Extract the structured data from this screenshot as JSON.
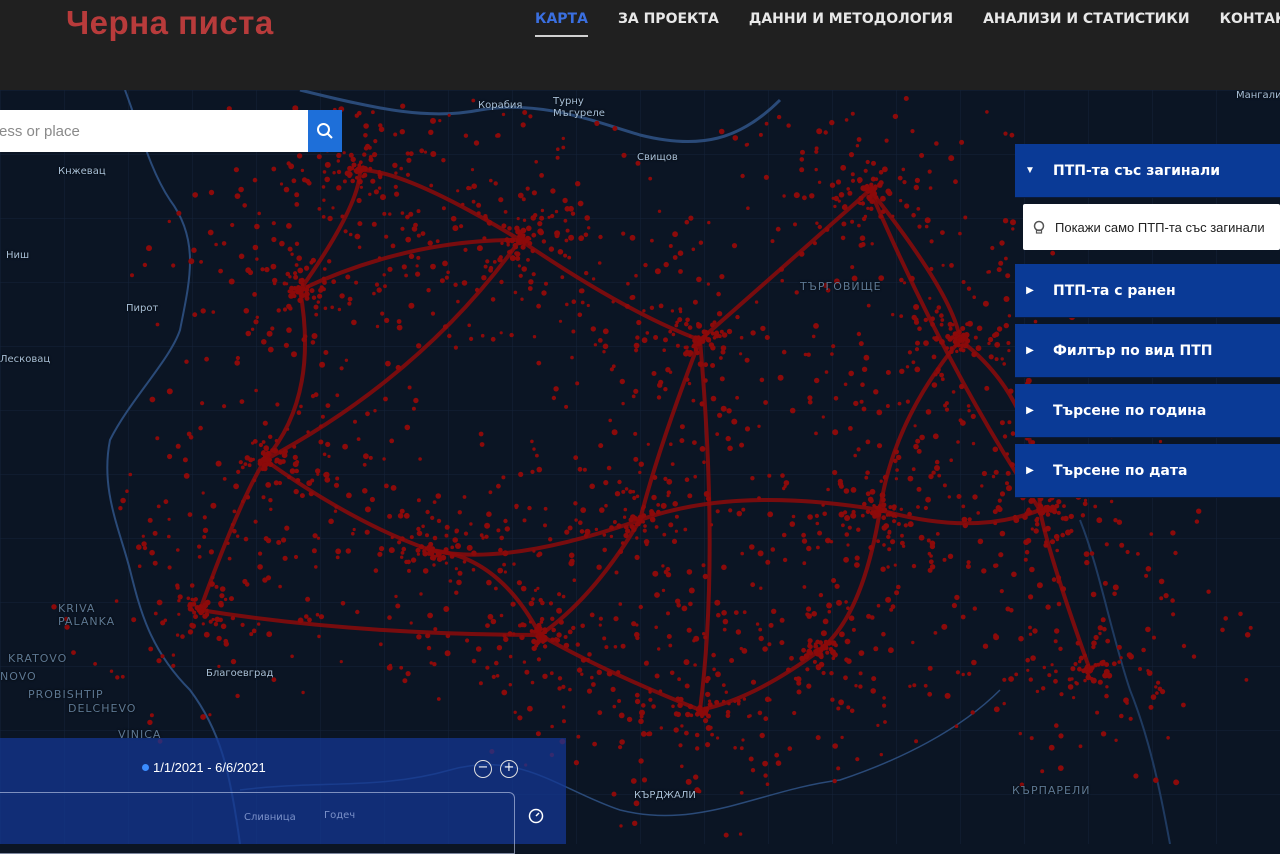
{
  "header": {
    "logo": "Черна писта",
    "nav": [
      {
        "label": "КАРТА",
        "active": true
      },
      {
        "label": "ЗА ПРОЕКТА",
        "active": false
      },
      {
        "label": "ДАННИ И МЕТОДОЛОГИЯ",
        "active": false
      },
      {
        "label": "АНАЛИЗИ И СТАТИСТИКИ",
        "active": false
      },
      {
        "label": "КОНТАКТИ",
        "active": false
      }
    ]
  },
  "search": {
    "placeholder": "ress or place",
    "icon": "search-icon"
  },
  "panel": {
    "items": [
      {
        "label": "ПТП-та със загинали",
        "expanded": true
      },
      {
        "label": "ПТП-та с ранен",
        "expanded": false
      },
      {
        "label": "Филтър по вид ПТП",
        "expanded": false
      },
      {
        "label": "Търсене по година",
        "expanded": false
      },
      {
        "label": "Търсене по дата",
        "expanded": false
      }
    ],
    "toggle_label": "Покажи само ПТП-та със загинали"
  },
  "timeline": {
    "date_range": "1/1/2021 - 6/6/2021",
    "zoom_out": "−",
    "zoom_in": "+",
    "labels": [
      "Сливница",
      "Годеч"
    ]
  },
  "map": {
    "labels": [
      {
        "text": "Корабия"
      },
      {
        "text": "Турну Мъгуреле"
      },
      {
        "text": "Свищов"
      },
      {
        "text": "Кнжевац"
      },
      {
        "text": "Ниш"
      },
      {
        "text": "Пирот"
      },
      {
        "text": "Лесковац"
      },
      {
        "text": "Мангалия"
      },
      {
        "text": "KRIVA PALANKA"
      },
      {
        "text": "KRATOVO"
      },
      {
        "text": "NOVO"
      },
      {
        "text": "PROBISHTIP"
      },
      {
        "text": "DELCHEVO"
      },
      {
        "text": "VINICA"
      },
      {
        "text": "Благоевград"
      },
      {
        "text": "ТЪРГОВИЩЕ"
      },
      {
        "text": "КЪРДЖАЛИ"
      },
      {
        "text": "КЪРПАРЕЛИ"
      }
    ],
    "colors": {
      "background": "#0b1524",
      "accident_dot": "#8c0a0a",
      "border": "#2a4a78"
    }
  }
}
